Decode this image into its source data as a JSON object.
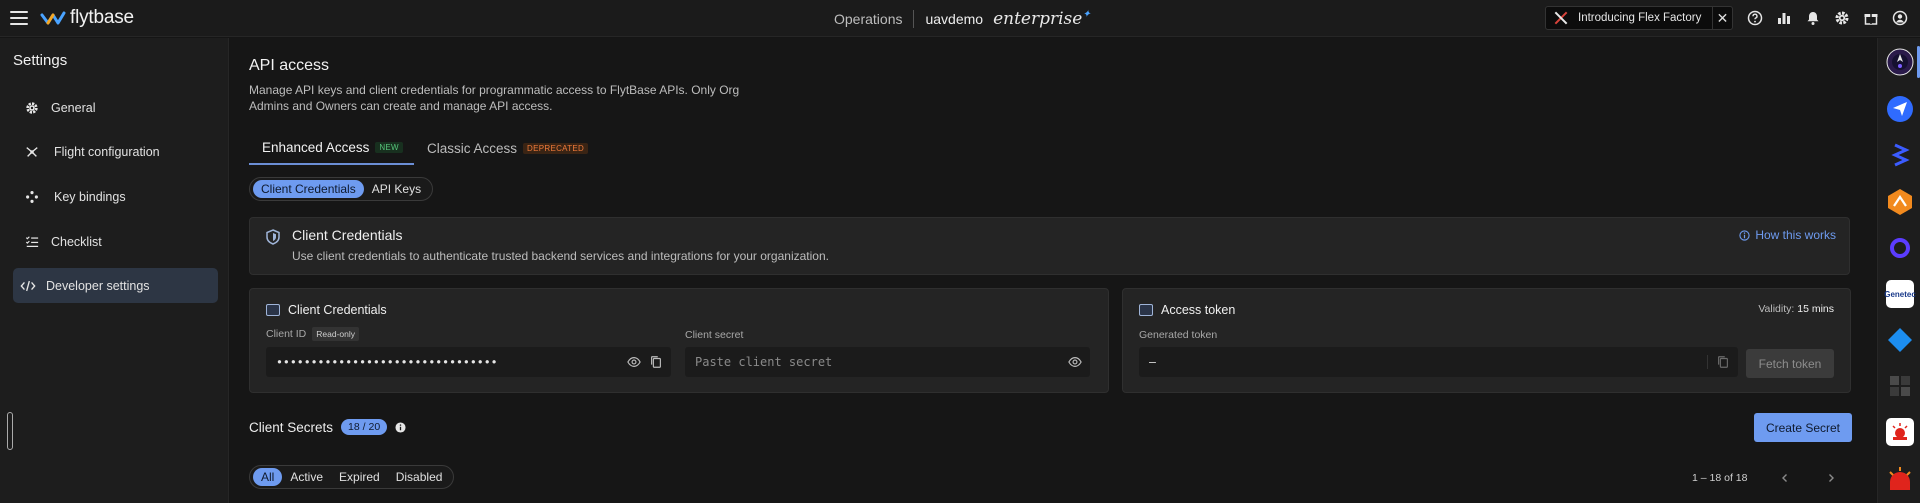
{
  "topbar": {
    "brand": "flytbase",
    "section": "Operations",
    "org": "uavdemo",
    "plan": "enterprise",
    "announcement": "Introducing Flex Factory",
    "icons": [
      "help-icon",
      "analytics-icon",
      "bell-icon",
      "gear-icon",
      "gift-icon",
      "account-icon"
    ]
  },
  "sidebar": {
    "title": "Settings",
    "items": [
      {
        "label": "General",
        "icon": "gear-icon"
      },
      {
        "label": "Flight configuration",
        "icon": "drone-icon"
      },
      {
        "label": "Key bindings",
        "icon": "gamepad-icon"
      },
      {
        "label": "Checklist",
        "icon": "checklist-icon"
      },
      {
        "label": "Developer settings",
        "icon": "code-icon",
        "active": true
      }
    ]
  },
  "main": {
    "title": "API access",
    "description": "Manage API keys and client credentials for programmatic access to FlytBase APIs. Only Org Admins and Owners can create and manage API access.",
    "tabs": [
      {
        "label": "Enhanced Access",
        "badge": "NEW"
      },
      {
        "label": "Classic Access",
        "badge": "DEPRECATED"
      }
    ],
    "segments": [
      "Client Credentials",
      "API Keys"
    ],
    "info": {
      "title": "Client Credentials",
      "description": "Use client credentials to authenticate trusted backend services and integrations for your organization.",
      "link": "How this works"
    },
    "credentials": {
      "title": "Client Credentials",
      "client_id_label": "Client ID",
      "readonly_badge": "Read-only",
      "client_id_value": "••••••••••••••••••••••••••••••••",
      "client_secret_label": "Client secret",
      "client_secret_placeholder": "Paste client secret"
    },
    "token": {
      "title": "Access token",
      "validity_label": "Validity:",
      "validity_value": "15 mins",
      "generated_label": "Generated token",
      "generated_value": "–",
      "fetch_label": "Fetch token"
    },
    "secrets": {
      "title": "Client Secrets",
      "count": "18 / 20",
      "create_label": "Create Secret",
      "filters": [
        "All",
        "Active",
        "Expired",
        "Disabled"
      ],
      "active_filter": "All",
      "pagination": "1 – 18 of 18"
    }
  },
  "colors": {
    "accent": "#6e9bf0",
    "new_badge": "#56c47a",
    "deprecated_badge": "#ef7a3a"
  },
  "rail": {
    "apps": [
      "profile-app-icon",
      "navigation-app-icon",
      "stripes-app-icon",
      "orange-hex-app-icon",
      "ring-app-icon",
      "genetec-app-icon",
      "diamond-app-icon",
      "grid-app-icon",
      "alarm-app-icon",
      "siren-app-icon"
    ],
    "genetec_label": "Genetec"
  }
}
